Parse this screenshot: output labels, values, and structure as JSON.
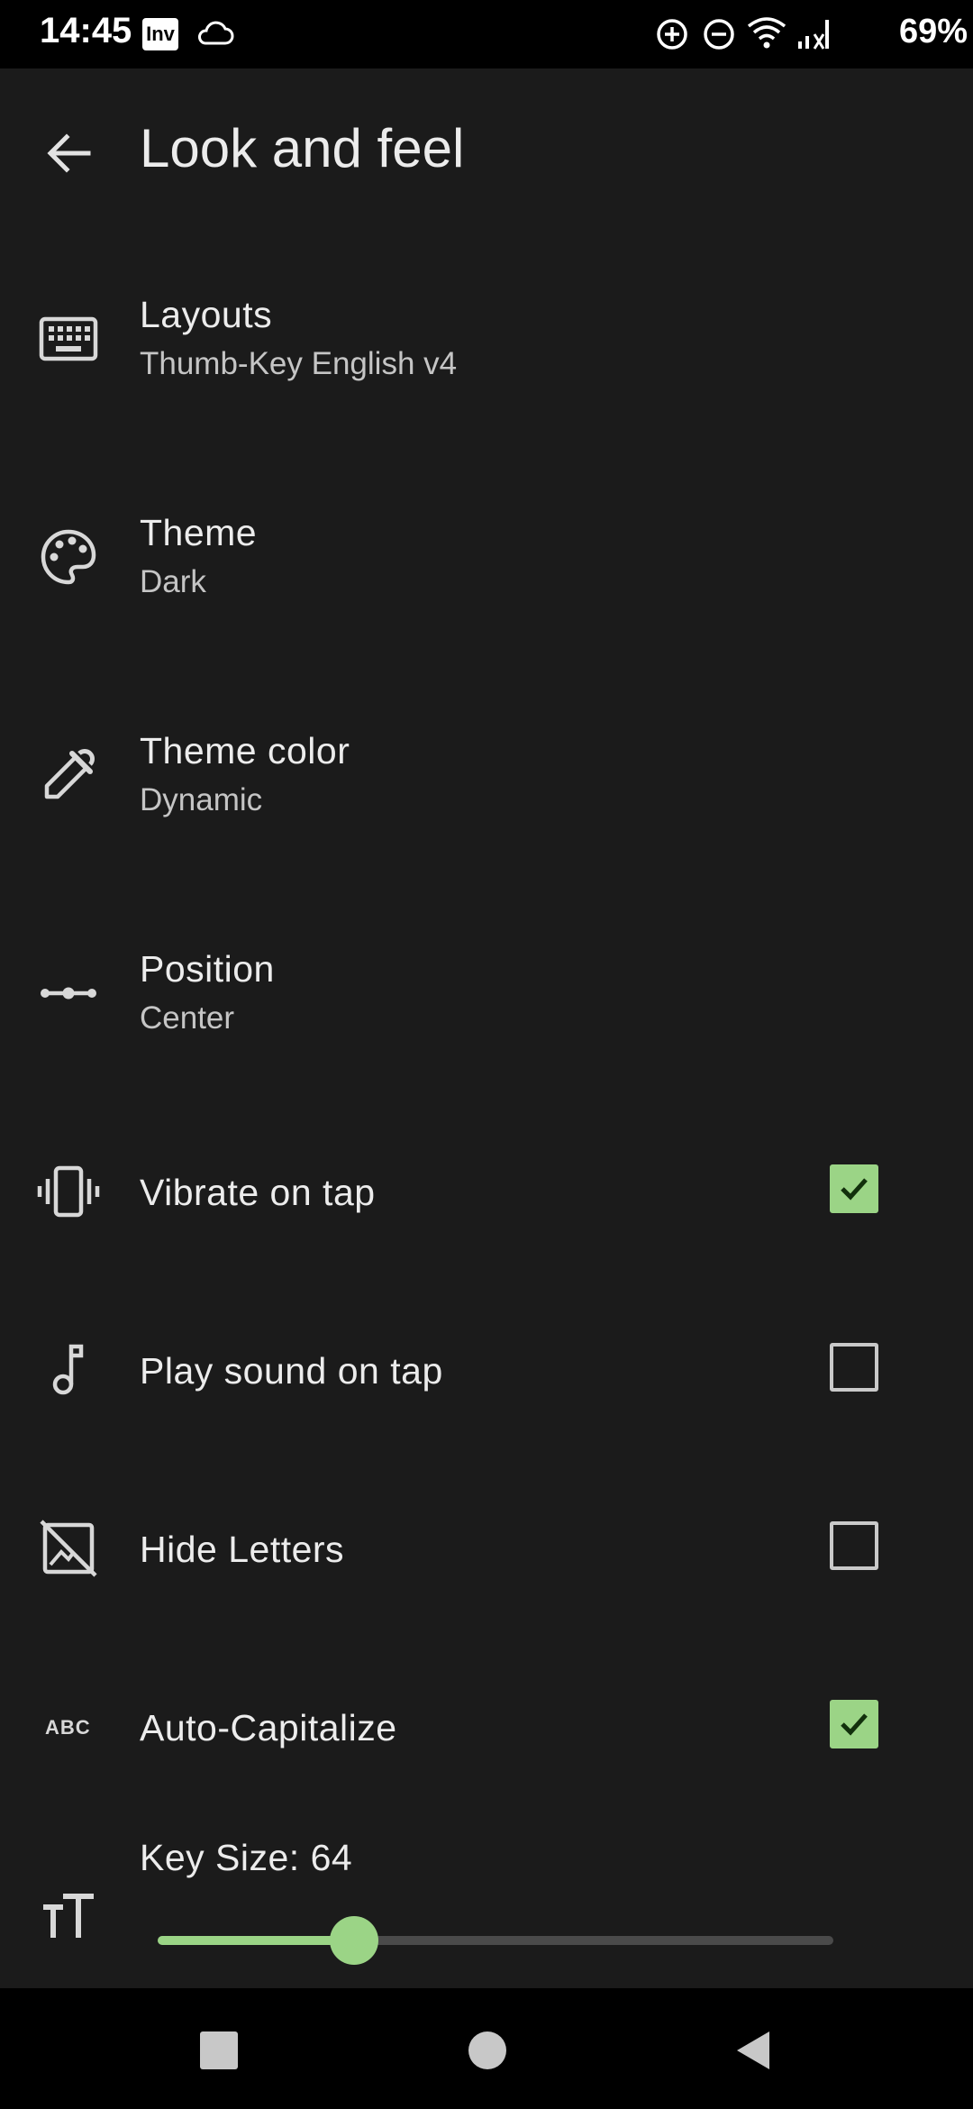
{
  "status_bar": {
    "time": "14:45",
    "app_icon_text": "Inv",
    "battery": "69%",
    "icons": [
      "cloud-icon",
      "data-saver-icon",
      "dnd-icon",
      "wifi-icon",
      "signal-icon"
    ]
  },
  "app_bar": {
    "title": "Look and feel",
    "back_icon": "arrow-back-icon"
  },
  "settings": {
    "layouts": {
      "label": "Layouts",
      "value": "Thumb-Key English v4",
      "icon": "keyboard-icon"
    },
    "theme": {
      "label": "Theme",
      "value": "Dark",
      "icon": "palette-icon"
    },
    "theme_color": {
      "label": "Theme color",
      "value": "Dynamic",
      "icon": "eyedropper-icon"
    },
    "position": {
      "label": "Position",
      "value": "Center",
      "icon": "position-icon"
    },
    "vibrate": {
      "label": "Vibrate on tap",
      "checked": true,
      "icon": "vibrate-icon"
    },
    "sound": {
      "label": "Play sound on tap",
      "checked": false,
      "icon": "music-note-icon"
    },
    "hide_letters": {
      "label": "Hide Letters",
      "checked": false,
      "icon": "hide-image-icon"
    },
    "auto_capitalize": {
      "label": "Auto-Capitalize",
      "checked": true,
      "icon": "abc-icon",
      "icon_text": "ABC"
    },
    "key_size": {
      "label": "Key Size: 64",
      "value": 64,
      "fraction": 0.29,
      "icon": "text-size-icon"
    }
  },
  "colors": {
    "background": "#1b1b1b",
    "accent": "#9bd486",
    "text": "#ececec",
    "subtext": "#c5c5c5"
  }
}
